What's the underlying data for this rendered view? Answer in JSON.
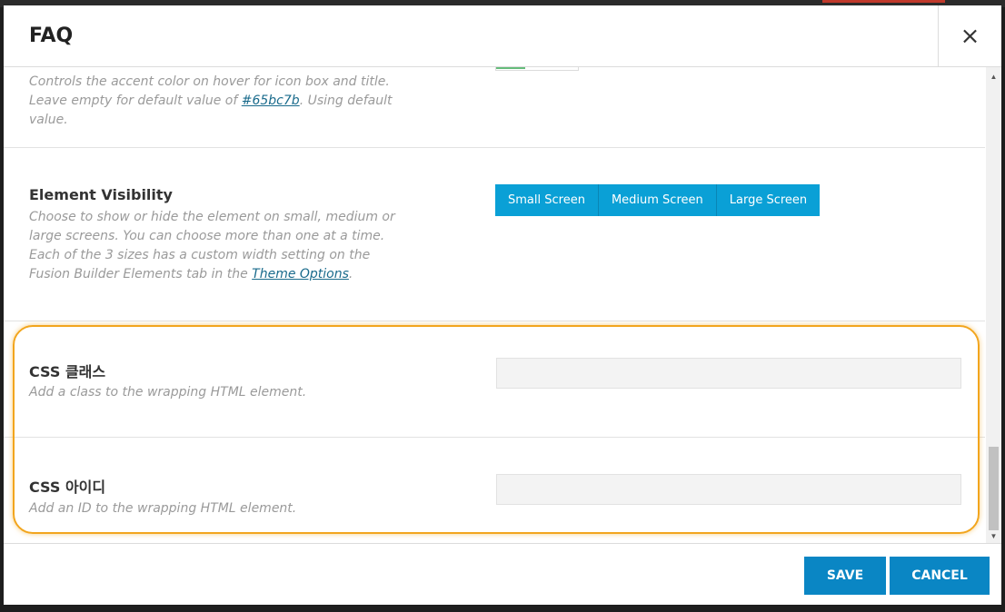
{
  "modal": {
    "title": "FAQ",
    "close_icon": "×"
  },
  "accent_option": {
    "desc_line1": "Controls the accent color on hover for icon box and title.",
    "desc_line2_prefix": "Leave empty for default value of ",
    "default_link": "#65bc7b",
    "desc_line2_suffix": ". Using default value.",
    "swatch_color": "#65bc7b"
  },
  "visibility": {
    "title": "Element Visibility",
    "desc_prefix": "Choose to show or hide the element on small, medium or large screens. You can choose more than one at a time. Each of the 3 sizes has a custom width setting on the Fusion Builder Elements tab in the ",
    "desc_link": "Theme Options",
    "desc_suffix": ".",
    "buttons": [
      "Small Screen",
      "Medium Screen",
      "Large Screen"
    ]
  },
  "css_class": {
    "title": "CSS 클래스",
    "desc": "Add a class to the wrapping HTML element.",
    "value": ""
  },
  "css_id": {
    "title": "CSS 아이디",
    "desc": "Add an ID to the wrapping HTML element.",
    "value": ""
  },
  "scrollbar": {
    "up_icon": "▲",
    "down_icon": "▼"
  },
  "footer": {
    "save_label": "SAVE",
    "cancel_label": "CANCEL"
  },
  "colors": {
    "button_blue": "#0aa0d6",
    "footer_blue": "#0a86c4",
    "highlight_orange": "#f2a51d"
  }
}
